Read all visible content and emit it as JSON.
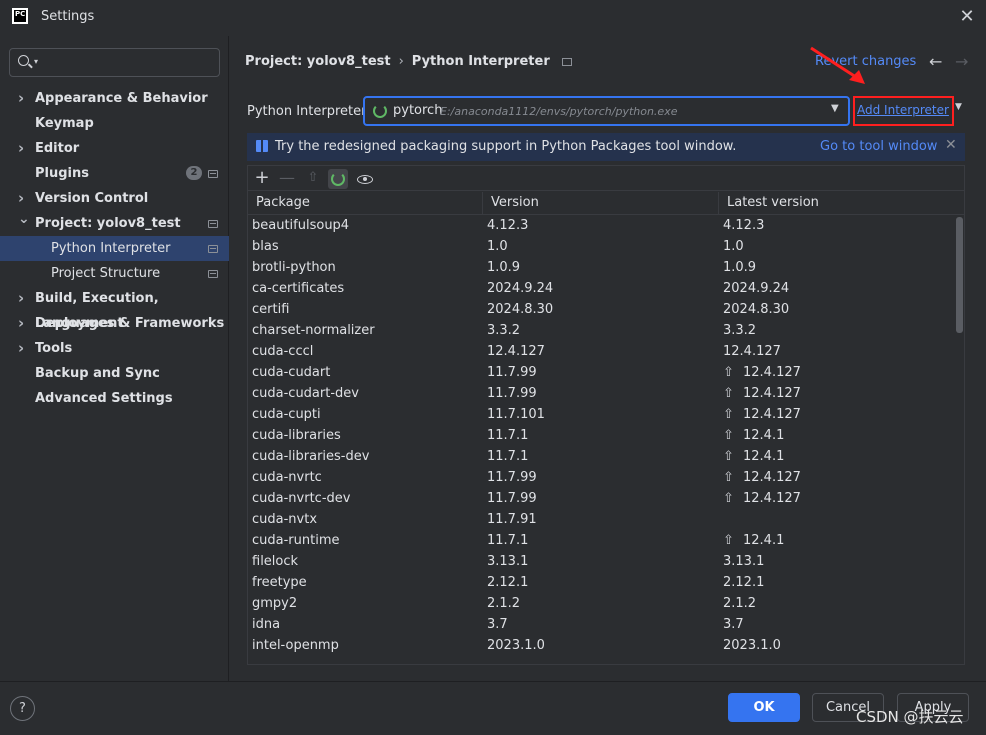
{
  "window": {
    "title": "Settings",
    "logo_text": "PC"
  },
  "sidebar": {
    "search_placeholder": "",
    "items": [
      {
        "label": "Appearance & Behavior",
        "expandable": true,
        "expanded": false
      },
      {
        "label": "Keymap",
        "expandable": false
      },
      {
        "label": "Editor",
        "expandable": true,
        "expanded": false
      },
      {
        "label": "Plugins",
        "expandable": false,
        "badge": "2"
      },
      {
        "label": "Version Control",
        "expandable": true,
        "expanded": false
      },
      {
        "label": "Project: yolov8_test",
        "expandable": true,
        "expanded": true
      },
      {
        "label": "Python Interpreter",
        "child": true,
        "selected": true
      },
      {
        "label": "Project Structure",
        "child": true
      },
      {
        "label": "Build, Execution, Deployment",
        "expandable": true,
        "expanded": false
      },
      {
        "label": "Languages & Frameworks",
        "expandable": true,
        "expanded": false
      },
      {
        "label": "Tools",
        "expandable": true,
        "expanded": false
      },
      {
        "label": "Backup and Sync",
        "expandable": false
      },
      {
        "label": "Advanced Settings",
        "expandable": false
      }
    ]
  },
  "header": {
    "breadcrumb_project": "Project: yolov8_test",
    "breadcrumb_page": "Python Interpreter",
    "revert_label": "Revert changes"
  },
  "interpreter": {
    "label": "Python Interpreter:",
    "name": "pytorch",
    "path": "E:/anaconda1112/envs/pytorch/python.exe",
    "add_label": "Add Interpreter"
  },
  "banner": {
    "message": "Try the redesigned packaging support in Python Packages tool window.",
    "link": "Go to tool window"
  },
  "table": {
    "headers": [
      "Package",
      "Version",
      "Latest version"
    ],
    "rows": [
      {
        "package": "beautifulsoup4",
        "version": "4.12.3",
        "latest": "4.12.3",
        "upgrade": false
      },
      {
        "package": "blas",
        "version": "1.0",
        "latest": "1.0",
        "upgrade": false
      },
      {
        "package": "brotli-python",
        "version": "1.0.9",
        "latest": "1.0.9",
        "upgrade": false
      },
      {
        "package": "ca-certificates",
        "version": "2024.9.24",
        "latest": "2024.9.24",
        "upgrade": false
      },
      {
        "package": "certifi",
        "version": "2024.8.30",
        "latest": "2024.8.30",
        "upgrade": false
      },
      {
        "package": "charset-normalizer",
        "version": "3.3.2",
        "latest": "3.3.2",
        "upgrade": false
      },
      {
        "package": "cuda-cccl",
        "version": "12.4.127",
        "latest": "12.4.127",
        "upgrade": false
      },
      {
        "package": "cuda-cudart",
        "version": "11.7.99",
        "latest": "12.4.127",
        "upgrade": true
      },
      {
        "package": "cuda-cudart-dev",
        "version": "11.7.99",
        "latest": "12.4.127",
        "upgrade": true
      },
      {
        "package": "cuda-cupti",
        "version": "11.7.101",
        "latest": "12.4.127",
        "upgrade": true
      },
      {
        "package": "cuda-libraries",
        "version": "11.7.1",
        "latest": "12.4.1",
        "upgrade": true
      },
      {
        "package": "cuda-libraries-dev",
        "version": "11.7.1",
        "latest": "12.4.1",
        "upgrade": true
      },
      {
        "package": "cuda-nvrtc",
        "version": "11.7.99",
        "latest": "12.4.127",
        "upgrade": true
      },
      {
        "package": "cuda-nvrtc-dev",
        "version": "11.7.99",
        "latest": "12.4.127",
        "upgrade": true
      },
      {
        "package": "cuda-nvtx",
        "version": "11.7.91",
        "latest": "",
        "upgrade": false
      },
      {
        "package": "cuda-runtime",
        "version": "11.7.1",
        "latest": "12.4.1",
        "upgrade": true
      },
      {
        "package": "filelock",
        "version": "3.13.1",
        "latest": "3.13.1",
        "upgrade": false
      },
      {
        "package": "freetype",
        "version": "2.12.1",
        "latest": "2.12.1",
        "upgrade": false
      },
      {
        "package": "gmpy2",
        "version": "2.1.2",
        "latest": "2.1.2",
        "upgrade": false
      },
      {
        "package": "idna",
        "version": "3.7",
        "latest": "3.7",
        "upgrade": false
      },
      {
        "package": "intel-openmp",
        "version": "2023.1.0",
        "latest": "2023.1.0",
        "upgrade": false
      }
    ]
  },
  "footer": {
    "help": "?",
    "ok": "OK",
    "cancel": "Cancel",
    "apply": "Apply",
    "watermark": "CSDN @扶云云"
  },
  "colors": {
    "accent": "#3574f0",
    "link": "#548af7",
    "highlight_box": "#ff1f1f"
  }
}
